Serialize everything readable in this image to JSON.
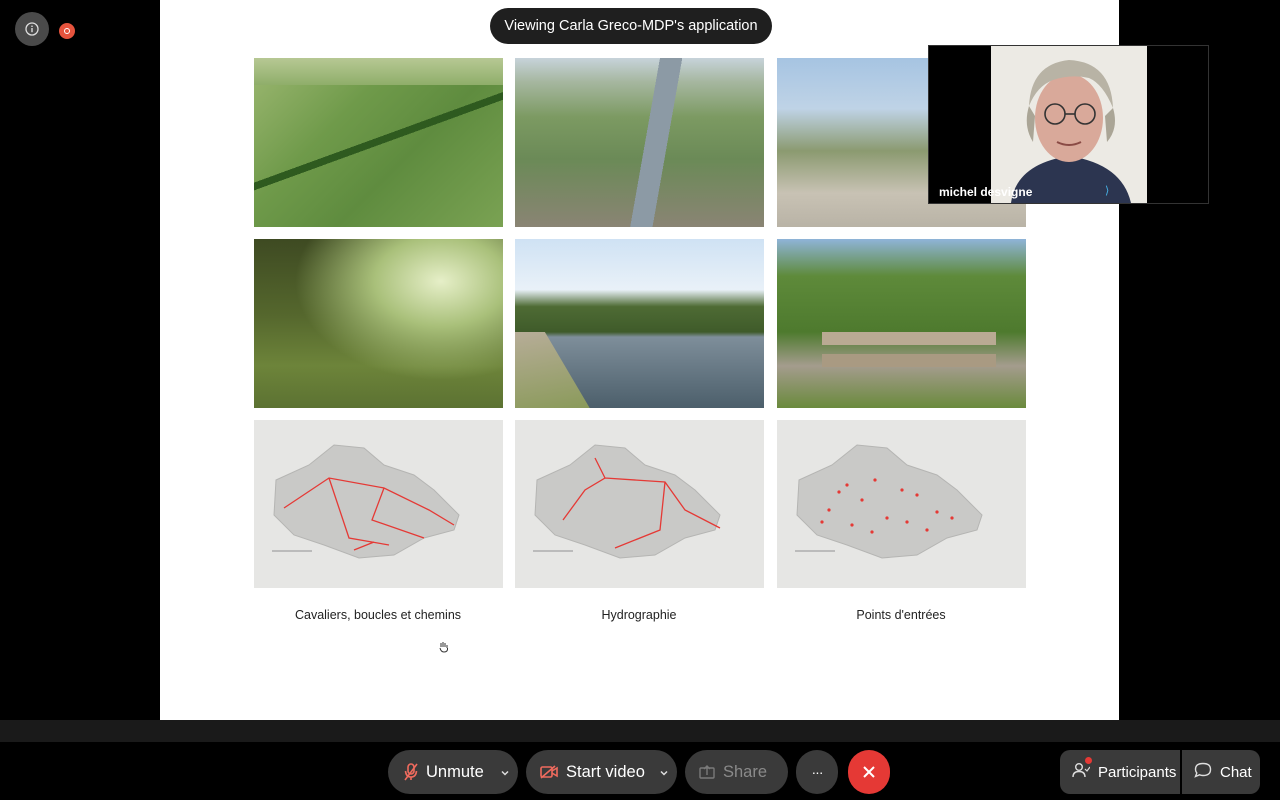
{
  "banner": {
    "text": "Viewing Carla Greco-MDP's application"
  },
  "slide": {
    "captions": [
      "Cavaliers, boucles et chemins",
      "Hydrographie",
      "Points d'entrées"
    ]
  },
  "participant": {
    "name": "michel desvigne"
  },
  "toolbar": {
    "unmute": "Unmute",
    "start_video": "Start video",
    "share": "Share",
    "more": "···",
    "participants": "Participants",
    "chat": "Chat"
  },
  "colors": {
    "end_call": "#e53935",
    "recording": "#e5533d",
    "route": "#e53935"
  }
}
